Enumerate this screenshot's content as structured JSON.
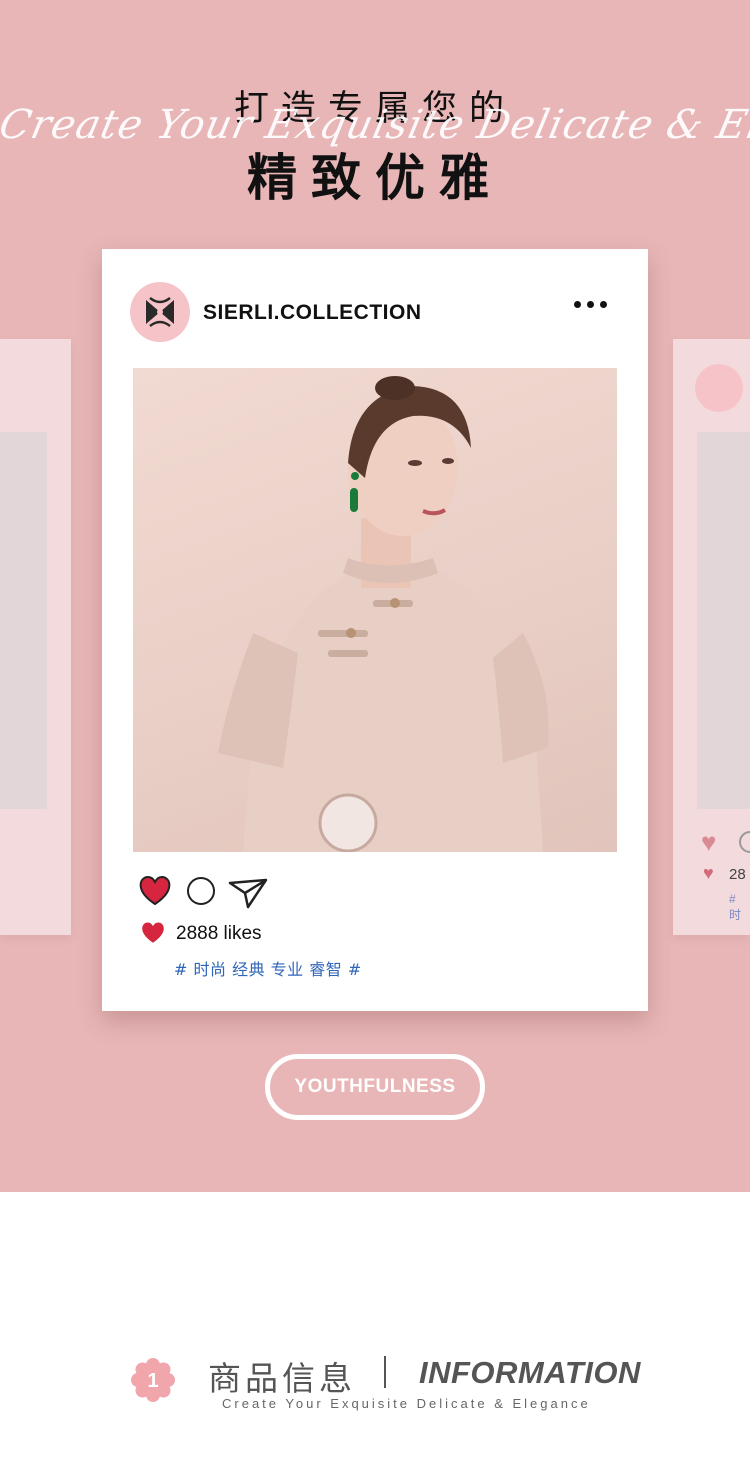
{
  "hero": {
    "headline_small": "打造专属您的",
    "script_text": "Create Your Exquisite Delicate & Elegance",
    "headline_big": "精致优雅"
  },
  "post": {
    "handle": "SIERLI.COLLECTION",
    "likes_text": "2888 likes",
    "tags": "# 时尚 经典 专业 睿智 #",
    "photo_icon": "model-photo",
    "accent_color": "#d6253f"
  },
  "side_right": {
    "likes_text": "28",
    "tags": "# 时"
  },
  "cta": {
    "label": "YOUTHFULNESS"
  },
  "information": {
    "badge_number": "1",
    "title_cn": "商品信息",
    "title_en": "INFORMATION",
    "subtitle": "Create Your Exquisite Delicate & Elegance"
  },
  "colors": {
    "background_pink": "#e8b6b7",
    "card_white": "#ffffff",
    "tag_blue": "#2f66b8",
    "heart_red": "#d6253f"
  }
}
